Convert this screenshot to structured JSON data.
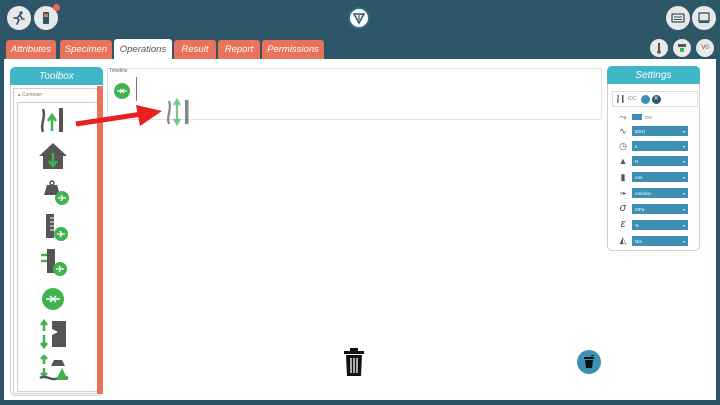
{
  "tabs": [
    {
      "label": "Attributes",
      "active": false
    },
    {
      "label": "Specimen",
      "active": false
    },
    {
      "label": "Operations",
      "active": true
    },
    {
      "label": "Result",
      "active": false
    },
    {
      "label": "Report",
      "active": false
    },
    {
      "label": "Permissions",
      "active": false
    }
  ],
  "header": {
    "version": "V0"
  },
  "toolbox": {
    "title": "Toolbox",
    "section": "Common"
  },
  "timeline": {
    "label": "Timeline"
  },
  "settings": {
    "title": "Settings",
    "selected_label": "IDC",
    "toggle_label": "ON",
    "dropdowns": [
      "50Hz",
      "s",
      "N",
      "mm",
      "mm/min",
      "MPa",
      "%",
      "N/s"
    ]
  },
  "colors": {
    "accent_tab": "#e8735a",
    "panel_header": "#3fb7c6",
    "dropdown": "#3e8fb4",
    "topbar": "#2d5668",
    "icon_green": "#3fb44e",
    "arrow_red": "#e8201f"
  }
}
